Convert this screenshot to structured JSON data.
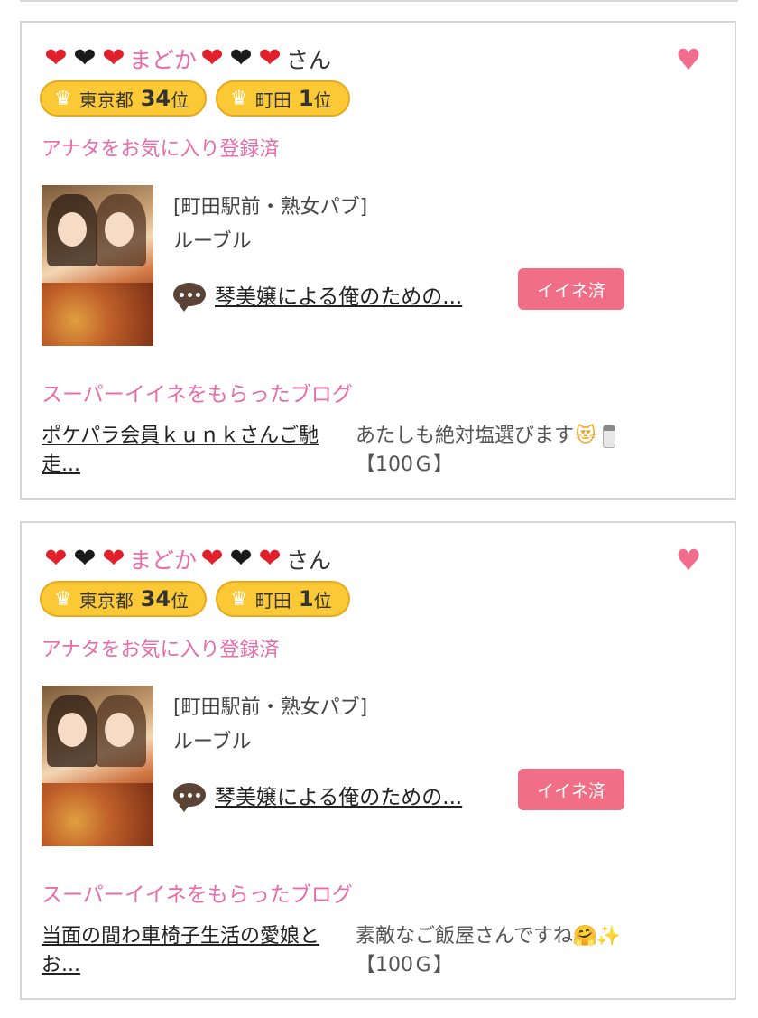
{
  "cards": [
    {
      "user": {
        "hearts_before": [
          "red",
          "black",
          "red"
        ],
        "name": "まどか",
        "hearts_after": [
          "red",
          "black",
          "red"
        ],
        "suffix": "さん"
      },
      "badges": [
        {
          "area": "東京都",
          "rank_num": "34",
          "rank_unit": "位"
        },
        {
          "area": "町田",
          "rank_num": "1",
          "rank_unit": "位"
        }
      ],
      "fav_status": "アナタをお気に入り登録済",
      "shop_category": "[町田駅前・熟女パブ]",
      "shop_name": "ルーブル",
      "post_title": "琴美嬢による俺のための...",
      "iine_label": "イイネ済",
      "super_heading": "スーパーイイネをもらったブログ",
      "blog_title": "ポケパラ会員ｋｕｎｋさんご馳走...",
      "blog_comment": "あたしも絶対塩選びます",
      "blog_emojis": [
        "heart-eyes-cat-icon",
        "salt-shaker-icon"
      ],
      "blog_reward": "【100Ｇ】"
    },
    {
      "user": {
        "hearts_before": [
          "red",
          "black",
          "red"
        ],
        "name": "まどか",
        "hearts_after": [
          "red",
          "black",
          "red"
        ],
        "suffix": "さん"
      },
      "badges": [
        {
          "area": "東京都",
          "rank_num": "34",
          "rank_unit": "位"
        },
        {
          "area": "町田",
          "rank_num": "1",
          "rank_unit": "位"
        }
      ],
      "fav_status": "アナタをお気に入り登録済",
      "shop_category": "[町田駅前・熟女パブ]",
      "shop_name": "ルーブル",
      "post_title": "琴美嬢による俺のための...",
      "iine_label": "イイネ済",
      "super_heading": "スーパーイイネをもらったブログ",
      "blog_title": "当面の間わ車椅子生活の愛娘とお...",
      "blog_comment": "素敵なご飯屋さんですね",
      "blog_emojis": [
        "hugging-face-icon",
        "sparkles-icon"
      ],
      "blog_reward": "【100Ｇ】"
    }
  ],
  "colors": {
    "accent_pink": "#e86ca8",
    "button_pink": "#f16f86",
    "badge_gold": "#fbc935",
    "heart_red": "#e0212b"
  }
}
